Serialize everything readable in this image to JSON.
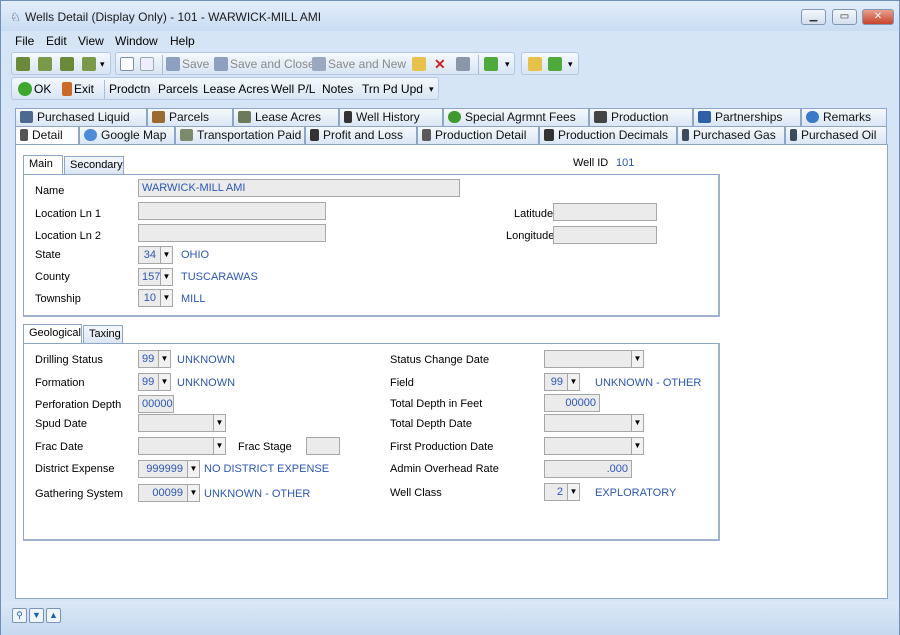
{
  "window": {
    "title": "Wells Detail (Display Only) - 101 - WARWICK-MILL AMI"
  },
  "menu": [
    "File",
    "Edit",
    "View",
    "Window",
    "Help"
  ],
  "toolbar1": {
    "save": "Save",
    "save_close": "Save and Close",
    "save_new": "Save and New"
  },
  "toolbar2": {
    "ok": "OK",
    "exit": "Exit",
    "prodctn": "Prodctn",
    "parcels": "Parcels",
    "lease_acres": "Lease Acres",
    "well_pl": "Well P/L",
    "notes": "Notes",
    "trn_pd_upd": "Trn Pd Upd"
  },
  "tabs_row1": [
    "Purchased Liquid",
    "Parcels",
    "Lease Acres",
    "Well History",
    "Special Agrmnt Fees",
    "Production",
    "Partnerships",
    "Remarks"
  ],
  "tabs_row2": [
    "Detail",
    "Google Map",
    "Transportation Paid",
    "Profit and Loss",
    "Production Detail",
    "Production Decimals",
    "Purchased Gas",
    "Purchased Oil"
  ],
  "subtabs1": [
    "Main",
    "Secondary"
  ],
  "well_id": {
    "label": "Well ID",
    "value": "101"
  },
  "main_panel": {
    "name_label": "Name",
    "name_value": "WARWICK-MILL AMI",
    "loc1_label": "Location Ln 1",
    "loc2_label": "Location Ln 2",
    "latitude_label": "Latitude",
    "longitude_label": "Longitude",
    "state_label": "State",
    "state_code": "34",
    "state_name": "OHIO",
    "county_label": "County",
    "county_code": "157",
    "county_name": "TUSCARAWAS",
    "township_label": "Township",
    "township_code": "10",
    "township_name": "MILL"
  },
  "subtabs2": [
    "Geological",
    "Taxing"
  ],
  "geo_panel": {
    "drilling_status_label": "Drilling Status",
    "drilling_status_code": "99",
    "drilling_status_name": "UNKNOWN",
    "formation_label": "Formation",
    "formation_code": "99",
    "formation_name": "UNKNOWN",
    "perf_depth_label": "Perforation Depth",
    "perf_depth_value": "00000",
    "spud_date_label": "Spud Date",
    "frac_date_label": "Frac Date",
    "frac_stage_label": "Frac Stage",
    "district_expense_label": "District Expense",
    "district_expense_code": "999999",
    "district_expense_name": "NO DISTRICT EXPENSE",
    "gathering_label": "Gathering System",
    "gathering_code": "00099",
    "gathering_name": "UNKNOWN - OTHER",
    "status_change_label": "Status Change Date",
    "field_label": "Field",
    "field_code": "99",
    "field_name": "UNKNOWN - OTHER",
    "total_depth_feet_label": "Total Depth in Feet",
    "total_depth_feet_value": "00000",
    "total_depth_date_label": "Total Depth Date",
    "first_prod_label": "First Production Date",
    "admin_rate_label": "Admin Overhead Rate",
    "admin_rate_value": ".000",
    "well_class_label": "Well Class",
    "well_class_code": "2",
    "well_class_name": "EXPLORATORY"
  }
}
